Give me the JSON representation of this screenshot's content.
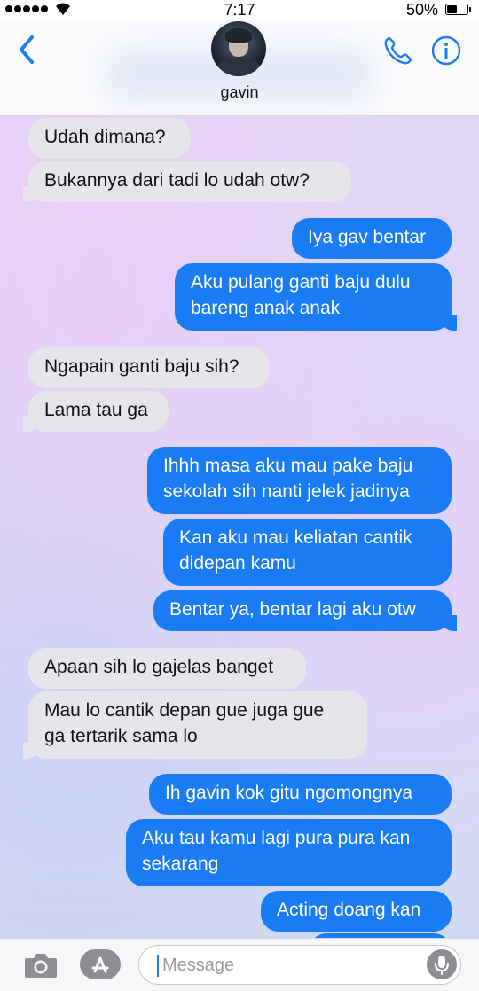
{
  "status": {
    "time": "7:17",
    "battery": "50%"
  },
  "header": {
    "contact_name": "gavin"
  },
  "messages": [
    {
      "dir": "in",
      "text": "Udah dimana?"
    },
    {
      "dir": "in",
      "text": "Bukannya dari tadi lo udah otw?"
    },
    {
      "dir": "out",
      "text": "Iya gav bentar"
    },
    {
      "dir": "out",
      "lines": [
        "Aku pulang ganti baju dulu",
        "bareng anak anak"
      ]
    },
    {
      "dir": "in",
      "text": "Ngapain ganti baju sih?"
    },
    {
      "dir": "in",
      "text": "Lama tau ga"
    },
    {
      "dir": "out",
      "lines": [
        "Ihhh masa aku mau pake baju",
        "sekolah sih nanti jelek jadinya"
      ]
    },
    {
      "dir": "out",
      "lines": [
        "Kan aku mau keliatan cantik",
        "didepan kamu"
      ]
    },
    {
      "dir": "out",
      "text": "Bentar ya, bentar lagi aku otw"
    },
    {
      "dir": "in",
      "text": "Apaan sih lo gajelas banget"
    },
    {
      "dir": "in",
      "lines": [
        "Mau lo cantik depan gue juga gue",
        "ga tertarik sama lo"
      ]
    },
    {
      "dir": "out",
      "text": "Ih gavin kok gitu ngomongnya"
    },
    {
      "dir": "out",
      "lines": [
        "Aku tau kamu lagi pura pura kan",
        "sekarang"
      ]
    },
    {
      "dir": "out",
      "text": "Acting doang kan"
    }
  ],
  "input": {
    "placeholder": "Message"
  },
  "colors": {
    "accent": "#1a7cf5",
    "incoming": "#e5e5ea",
    "outgoing": "#1a7cf5"
  },
  "icons": [
    "back-chevron-icon",
    "phone-icon",
    "info-icon",
    "camera-icon",
    "app-store-icon",
    "microphone-icon"
  ]
}
